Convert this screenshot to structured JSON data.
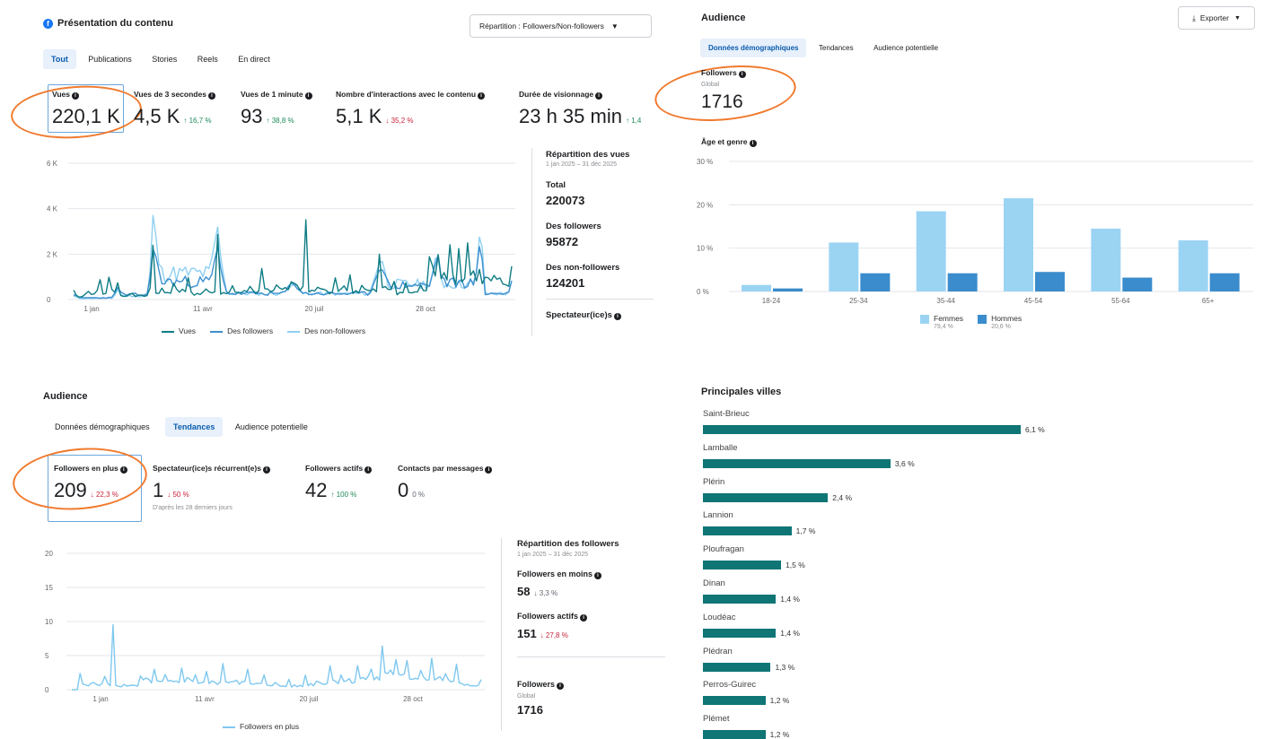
{
  "colors": {
    "teal": "#0f7c84",
    "blue": "#3d8fcf",
    "lightblue": "#8fd0f2",
    "bar_dark": "#3a8ccc",
    "bar_light": "#9bd4f3",
    "city_bar": "#0f7575",
    "accent_ring": "#f07a2e",
    "green": "#1e8a5a",
    "red": "#c8243a"
  },
  "content_overview": {
    "title": "Présentation du contenu",
    "dropdown_label": "Répartition : Followers/Non-followers",
    "tabs": [
      "Tout",
      "Publications",
      "Stories",
      "Reels",
      "En direct"
    ],
    "metrics": [
      {
        "label": "Vues",
        "value": "220,1 K",
        "change": ""
      },
      {
        "label": "Vues de 3 secondes",
        "value": "4,5 K",
        "change": "↑ 16,7 %"
      },
      {
        "label": "Vues de 1 minute",
        "value": "93",
        "change": "↑ 38,8 %"
      },
      {
        "label": "Nombre d'interactions avec le contenu",
        "value": "5,1 K",
        "change": "↓ 35,2 %"
      },
      {
        "label": "Durée de visionnage",
        "value": "23 h 35 min",
        "change": "↑ 1,4"
      }
    ],
    "side": {
      "title": "Répartition des vues",
      "period": "1 jan 2025 – 31 déc 2025",
      "total_label": "Total",
      "total_value": "220073",
      "followers_label": "Des followers",
      "followers_value": "95872",
      "nonfollowers_label": "Des non-followers",
      "nonfollowers_value": "124201",
      "spectators_label": "Spectateur(ice)s"
    },
    "legend": [
      "Vues",
      "Des followers",
      "Des non-followers"
    ]
  },
  "audience_demo": {
    "title": "Audience",
    "export_label": "Exporter",
    "tabs": [
      "Données démographiques",
      "Tendances",
      "Audience potentielle"
    ],
    "followers_label": "Followers",
    "followers_scope": "Global",
    "followers_value": "1716",
    "age_gender_label": "Âge et genre",
    "legend": [
      {
        "name": "Femmes",
        "pct": "79,4 %"
      },
      {
        "name": "Hommes",
        "pct": "20,6 %"
      }
    ]
  },
  "audience_trends": {
    "title": "Audience",
    "tabs": [
      "Données démographiques",
      "Tendances",
      "Audience potentielle"
    ],
    "metrics": [
      {
        "label": "Followers en plus",
        "value": "209",
        "change": "↓ 22,3 %"
      },
      {
        "label": "Spectateur(ice)s récurrent(e)s",
        "value": "1",
        "change": "↓ 50 %"
      },
      {
        "label": "Followers actifs",
        "value": "42",
        "change": "↑ 100 %"
      },
      {
        "label": "Contacts par messages",
        "value": "0",
        "change": "0 %"
      }
    ],
    "note": "D'après les 28 derniers jours",
    "side": {
      "title": "Répartition des followers",
      "period": "1 jan 2025 – 31 déc 2025",
      "lost_label": "Followers en moins",
      "lost_value": "58",
      "lost_change": "↓ 3,3 %",
      "active_label": "Followers actifs",
      "active_value": "151",
      "active_change": "↓ 27,8 %",
      "followers_label": "Followers",
      "followers_scope": "Global",
      "followers_value": "1716"
    },
    "legend": [
      "Followers en plus"
    ]
  },
  "cities": {
    "title": "Principales villes",
    "items": [
      {
        "name": "Saint-Brieuc",
        "pct": "6,1 %",
        "value": 6.1
      },
      {
        "name": "Lamballe",
        "pct": "3,6 %",
        "value": 3.6
      },
      {
        "name": "Plérin",
        "pct": "2,4 %",
        "value": 2.4
      },
      {
        "name": "Lannion",
        "pct": "1,7 %",
        "value": 1.7
      },
      {
        "name": "Ploufragan",
        "pct": "1,5 %",
        "value": 1.5
      },
      {
        "name": "Dinan",
        "pct": "1,4 %",
        "value": 1.4
      },
      {
        "name": "Loudéac",
        "pct": "1,4 %",
        "value": 1.4
      },
      {
        "name": "Plédran",
        "pct": "1,3 %",
        "value": 1.3
      },
      {
        "name": "Perros-Guirec",
        "pct": "1,2 %",
        "value": 1.2
      },
      {
        "name": "Plémet",
        "pct": "1,2 %",
        "value": 1.2
      }
    ]
  },
  "chart_data": [
    {
      "type": "line",
      "x_ticks": [
        "1 jan",
        "11 avr",
        "20 juil",
        "28 oct"
      ],
      "y_ticks": [
        "0",
        "2 K",
        "4 K",
        "6 K"
      ],
      "ylim": [
        0,
        6000
      ],
      "series": [
        {
          "name": "Vues",
          "color": "#0f7c84",
          "peaks": [
            [
              0.0,
              250
            ],
            [
              0.03,
              800
            ],
            [
              0.06,
              600
            ],
            [
              0.08,
              900
            ],
            [
              0.1,
              700
            ],
            [
              0.13,
              300
            ],
            [
              0.18,
              4400
            ],
            [
              0.2,
              500
            ],
            [
              0.23,
              900
            ],
            [
              0.26,
              1000
            ],
            [
              0.3,
              500
            ],
            [
              0.33,
              3800
            ],
            [
              0.36,
              600
            ],
            [
              0.4,
              700
            ],
            [
              0.43,
              1200
            ],
            [
              0.46,
              800
            ],
            [
              0.5,
              1000
            ],
            [
              0.53,
              3200
            ],
            [
              0.56,
              700
            ],
            [
              0.6,
              1300
            ],
            [
              0.63,
              900
            ],
            [
              0.66,
              700
            ],
            [
              0.7,
              2700
            ],
            [
              0.73,
              900
            ],
            [
              0.76,
              600
            ],
            [
              0.79,
              800
            ],
            [
              0.81,
              2400
            ],
            [
              0.83,
              2700
            ],
            [
              0.86,
              2200
            ],
            [
              0.88,
              1800
            ],
            [
              0.9,
              2100
            ],
            [
              0.93,
              5400
            ],
            [
              0.95,
              1600
            ],
            [
              0.97,
              2600
            ],
            [
              1.0,
              1000
            ]
          ]
        },
        {
          "name": "Des followers",
          "color": "#3d8fcf",
          "peaks": [
            [
              0.0,
              150
            ],
            [
              0.1,
              400
            ],
            [
              0.18,
              1800
            ],
            [
              0.33,
              1500
            ],
            [
              0.5,
              500
            ],
            [
              0.7,
              1200
            ],
            [
              0.83,
              1400
            ],
            [
              0.93,
              2300
            ],
            [
              1.0,
              500
            ]
          ]
        },
        {
          "name": "Des non-followers",
          "color": "#8fd0f2",
          "peaks": [
            [
              0.0,
              100
            ],
            [
              0.1,
              300
            ],
            [
              0.18,
              2600
            ],
            [
              0.33,
              2200
            ],
            [
              0.5,
              500
            ],
            [
              0.7,
              1500
            ],
            [
              0.83,
              1300
            ],
            [
              0.93,
              3100
            ],
            [
              1.0,
              500
            ]
          ]
        }
      ]
    },
    {
      "type": "bar",
      "categories": [
        "18-24",
        "25-34",
        "35-44",
        "45-54",
        "55-64",
        "65+"
      ],
      "series": [
        {
          "name": "Femmes",
          "values": [
            1.5,
            11.3,
            18.5,
            21.5,
            14.5,
            11.8
          ],
          "color": "#9bd4f3"
        },
        {
          "name": "Hommes",
          "values": [
            0.7,
            4.2,
            4.2,
            4.5,
            3.2,
            4.2
          ],
          "color": "#3a8ccc"
        }
      ],
      "y_ticks": [
        "0 %",
        "10 %",
        "20 %",
        "30 %"
      ],
      "ylim": [
        0,
        30
      ]
    },
    {
      "type": "line",
      "x_ticks": [
        "1 jan",
        "11 avr",
        "20 juil",
        "28 oct"
      ],
      "y_ticks": [
        "0",
        "5",
        "10",
        "15",
        "20"
      ],
      "ylim": [
        0,
        20
      ],
      "series": [
        {
          "name": "Followers en plus",
          "color": "#7fc8ef",
          "peaks": [
            [
              0.0,
              0
            ],
            [
              0.02,
              1.5
            ],
            [
              0.05,
              2
            ],
            [
              0.08,
              1.5
            ],
            [
              0.1,
              11
            ],
            [
              0.13,
              1
            ],
            [
              0.17,
              2.5
            ],
            [
              0.2,
              3
            ],
            [
              0.23,
              2
            ],
            [
              0.27,
              3.5
            ],
            [
              0.3,
              2.8
            ],
            [
              0.33,
              2
            ],
            [
              0.37,
              3
            ],
            [
              0.4,
              2.5
            ],
            [
              0.43,
              2
            ],
            [
              0.47,
              1.5
            ],
            [
              0.5,
              2
            ],
            [
              0.53,
              1
            ],
            [
              0.57,
              1.5
            ],
            [
              0.6,
              2
            ],
            [
              0.63,
              3
            ],
            [
              0.66,
              2.5
            ],
            [
              0.7,
              4
            ],
            [
              0.73,
              3
            ],
            [
              0.76,
              8.5
            ],
            [
              0.79,
              5
            ],
            [
              0.82,
              3.5
            ],
            [
              0.85,
              4
            ],
            [
              0.88,
              3.5
            ],
            [
              0.91,
              3
            ],
            [
              0.94,
              2.5
            ],
            [
              0.97,
              1.5
            ],
            [
              1.0,
              1
            ]
          ]
        }
      ]
    },
    {
      "type": "bar",
      "categories": [
        "Saint-Brieuc",
        "Lamballe",
        "Plérin",
        "Lannion",
        "Ploufragan",
        "Dinan",
        "Loudéac",
        "Plédran",
        "Perros-Guirec",
        "Plémet"
      ],
      "values": [
        6.1,
        3.6,
        2.4,
        1.7,
        1.5,
        1.4,
        1.4,
        1.3,
        1.2,
        1.2
      ],
      "title": "Principales villes"
    }
  ]
}
